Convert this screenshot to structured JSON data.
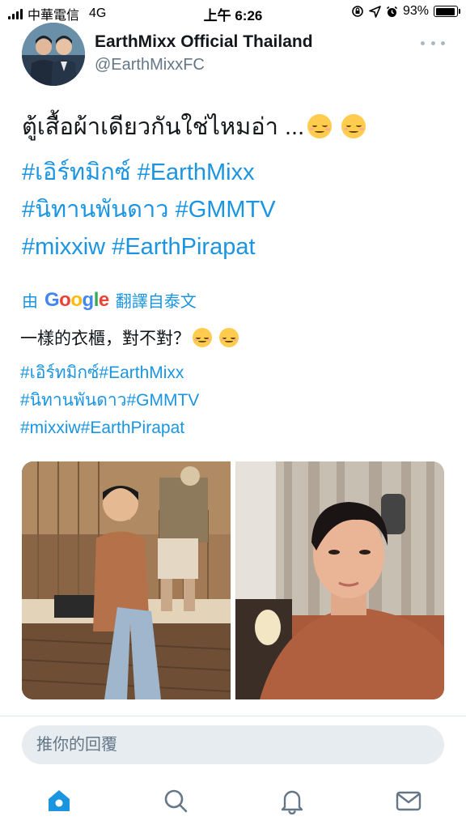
{
  "status_bar": {
    "carrier": "中華電信",
    "network": "4G",
    "time": "上午 6:26",
    "battery": "93%",
    "battery_level": 0.93
  },
  "header": {
    "display_name": "EarthMixx Official Thailand",
    "handle": "@EarthMixxFC"
  },
  "tweet": {
    "text": "ตู้เสื้อผ้าเดียวกันใช่ไหมอ่า ...",
    "hashtags": [
      "#เอิร์ทมิกซ์",
      "#EarthMixx",
      "#นิทานพันดาว",
      "#GMMTV",
      "#mixxiw",
      "#EarthPirapat"
    ]
  },
  "translation": {
    "by_label": "由",
    "google": "Google",
    "label": "翻譯自泰文",
    "text": "一樣的衣櫃，對不對？",
    "hashtag_lines": [
      "#เอิร์ทมิกซ์#EarthMixx",
      "#นิทานพันดาว#GMMTV",
      "#mixxiw#EarthPirapat"
    ]
  },
  "media": {
    "photos": [
      "photo-1",
      "photo-2"
    ]
  },
  "reply": {
    "placeholder": "推你的回覆"
  },
  "icons": {
    "home": "home-icon",
    "search": "search-icon",
    "notifications": "bell-icon",
    "messages": "mail-icon"
  },
  "colors": {
    "accent": "#1b95e0",
    "secondary_text": "#657786",
    "reply_bg": "#e6ecf0"
  }
}
